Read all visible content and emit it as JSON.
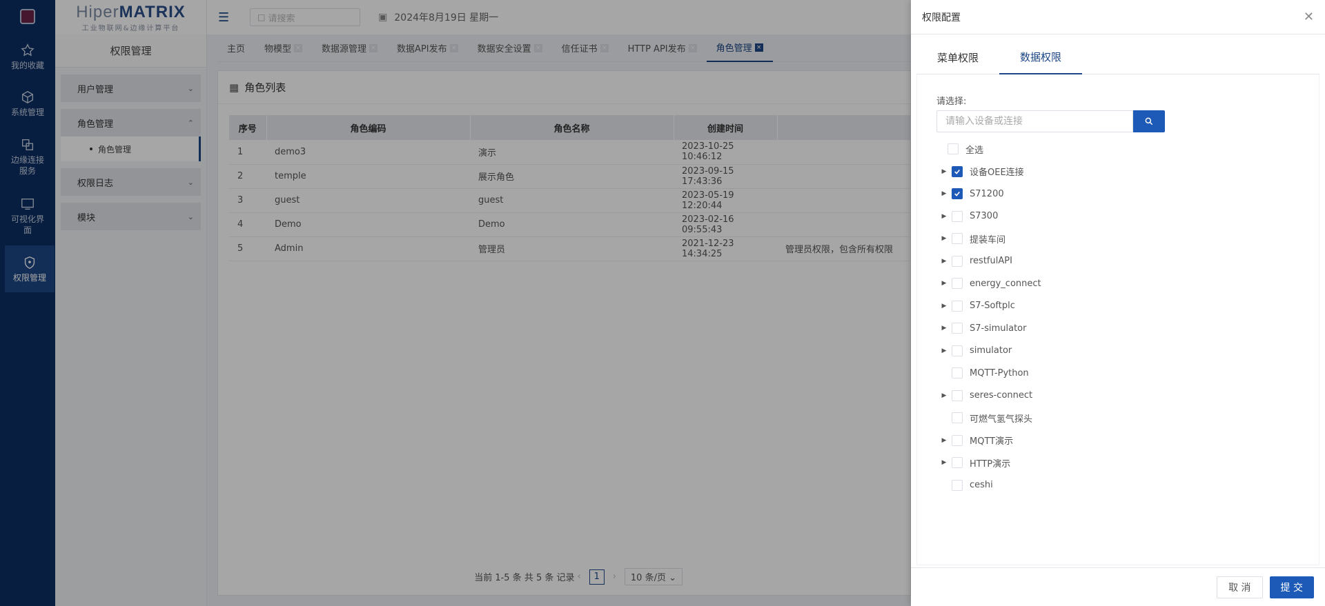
{
  "rail": {
    "items": [
      {
        "label": "我的收藏",
        "icon": "star-icon"
      },
      {
        "label": "系统管理",
        "icon": "cube-icon"
      },
      {
        "label": "边缘连接服务",
        "icon": "connect-icon"
      },
      {
        "label": "可视化界面",
        "icon": "monitor-icon"
      },
      {
        "label": "权限管理",
        "icon": "shield-icon"
      }
    ]
  },
  "brand": {
    "name_light": "Hiper",
    "name_bold": "MATRIX",
    "tagline": "工业物联网&边缘计算平台"
  },
  "sidebar": {
    "title": "权限管理",
    "groups": [
      {
        "label": "用户管理"
      },
      {
        "label": "角色管理",
        "sub": "角色管理"
      },
      {
        "label": "权限日志"
      },
      {
        "label": "模块"
      }
    ]
  },
  "topbar": {
    "search_placeholder": "请搜索",
    "date": "2024年8月19日 星期一"
  },
  "tabs": [
    {
      "label": "主页"
    },
    {
      "label": "物模型"
    },
    {
      "label": "数据源管理"
    },
    {
      "label": "数据API发布"
    },
    {
      "label": "数据安全设置"
    },
    {
      "label": "信任证书"
    },
    {
      "label": "HTTP API发布"
    },
    {
      "label": "角色管理"
    }
  ],
  "panel": {
    "title": "角色列表",
    "headers": [
      "序号",
      "角色编码",
      "角色名称",
      "创建时间",
      ""
    ],
    "rows": [
      [
        "1",
        "demo3",
        "演示",
        "2023-10-25 10:46:12",
        ""
      ],
      [
        "2",
        "temple",
        "展示角色",
        "2023-09-15 17:43:36",
        ""
      ],
      [
        "3",
        "guest",
        "guest",
        "2023-05-19 12:20:44",
        ""
      ],
      [
        "4",
        "Demo",
        "Demo",
        "2023-02-16 09:55:43",
        ""
      ],
      [
        "5",
        "Admin",
        "管理员",
        "2021-12-23 14:34:25",
        "管理员权限，包含所有权限"
      ]
    ],
    "pager": {
      "summary": "当前 1-5 条 共 5 条 记录",
      "page": "1",
      "size": "10 条/页"
    }
  },
  "drawer": {
    "title": "权限配置",
    "tabs": [
      "菜单权限",
      "数据权限"
    ],
    "select_label": "请选择:",
    "search_placeholder": "请输入设备或连接",
    "select_all": "全选",
    "items": [
      {
        "label": "设备OEE连接",
        "checked": true,
        "expandable": true
      },
      {
        "label": "S71200",
        "checked": true,
        "expandable": true
      },
      {
        "label": "S7300",
        "checked": false,
        "expandable": true
      },
      {
        "label": "提装车间",
        "checked": false,
        "expandable": true
      },
      {
        "label": "restfulAPI",
        "checked": false,
        "expandable": true
      },
      {
        "label": "energy_connect",
        "checked": false,
        "expandable": true
      },
      {
        "label": "S7-Softplc",
        "checked": false,
        "expandable": true
      },
      {
        "label": "S7-simulator",
        "checked": false,
        "expandable": true
      },
      {
        "label": "simulator",
        "checked": false,
        "expandable": true
      },
      {
        "label": "MQTT-Python",
        "checked": false,
        "expandable": false
      },
      {
        "label": "seres-connect",
        "checked": false,
        "expandable": true
      },
      {
        "label": "可燃气氢气探头",
        "checked": false,
        "expandable": false
      },
      {
        "label": "MQTT演示",
        "checked": false,
        "expandable": true
      },
      {
        "label": "HTTP演示",
        "checked": false,
        "expandable": true
      },
      {
        "label": "ceshi",
        "checked": false,
        "expandable": false
      }
    ],
    "cancel": "取 消",
    "submit": "提 交"
  },
  "colors": {
    "primary": "#1d5ab7",
    "rail": "#0d2f63"
  }
}
